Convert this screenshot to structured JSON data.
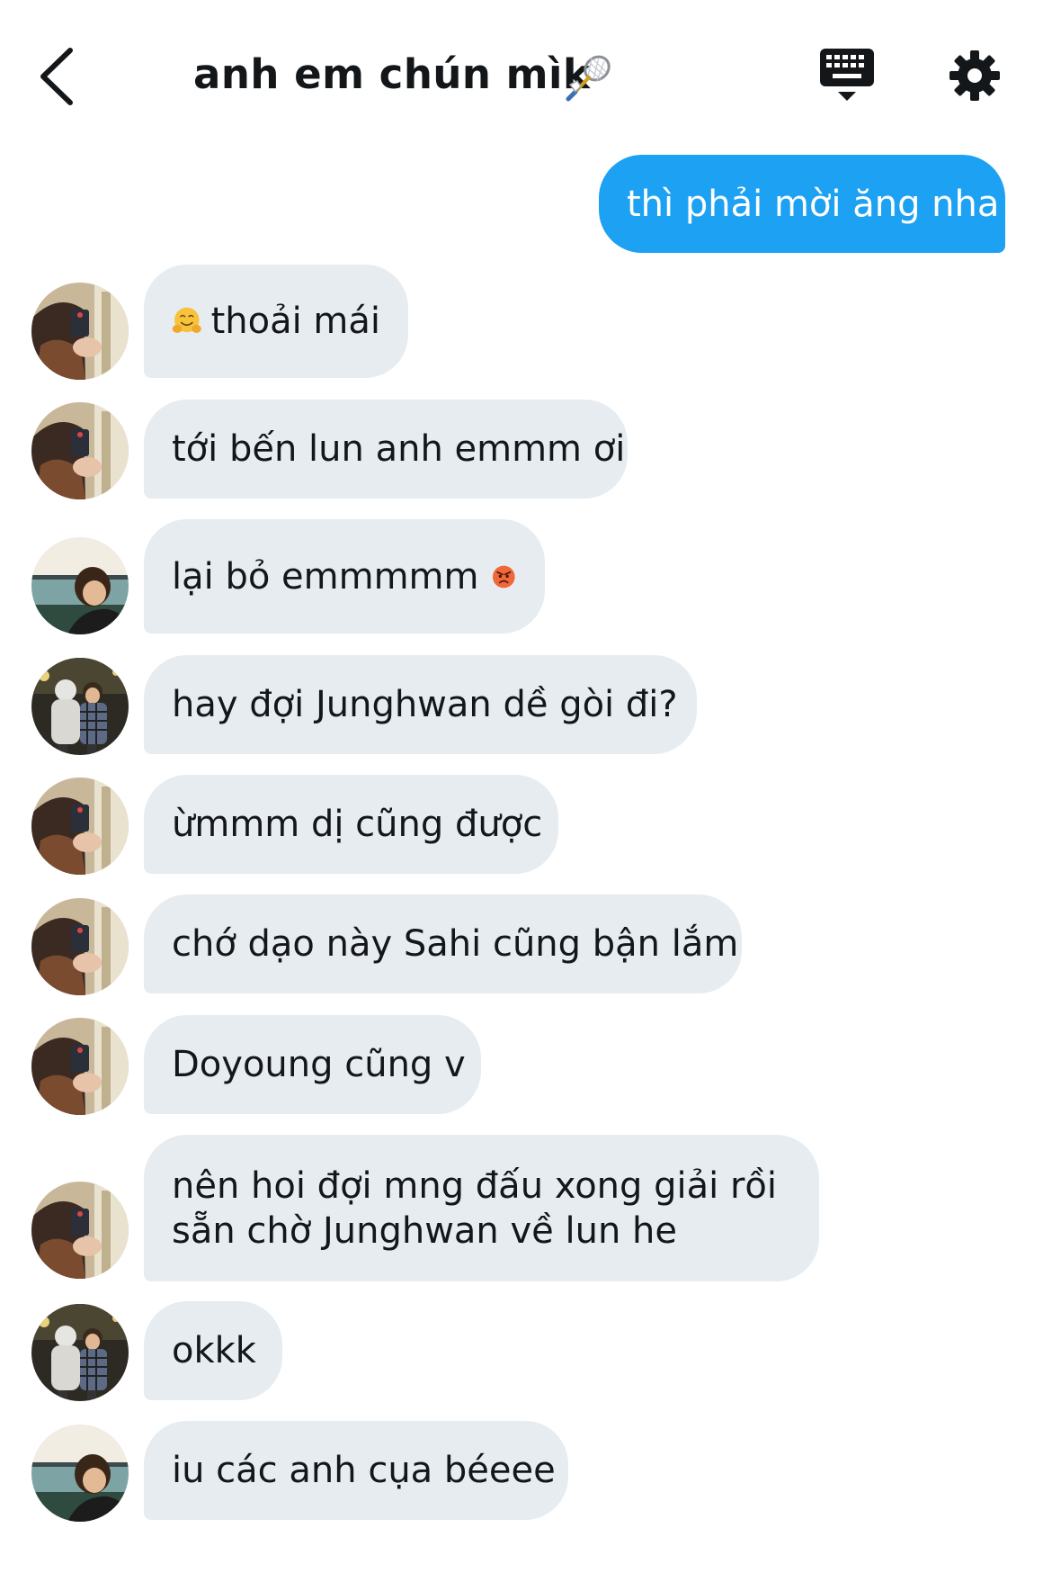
{
  "header": {
    "title": "anh em chún mìk",
    "title_icon": "badminton-icon",
    "back_icon": "chevron-left-icon",
    "keyboard_icon": "keyboard-icon",
    "settings_icon": "gear-icon"
  },
  "colors": {
    "sent_bubble": "#1da1f2",
    "received_bubble": "#e7ecf0",
    "text": "#14171a"
  },
  "messages": [
    {
      "direction": "sent",
      "text": "thì phải mời ăng nha"
    },
    {
      "direction": "received",
      "avatar": "user-a",
      "emoji": "hugging-face-emoji",
      "text": "thoải mái"
    },
    {
      "direction": "received",
      "avatar": "user-a",
      "text": "tới bến lun anh emmm ơi"
    },
    {
      "direction": "received",
      "avatar": "user-b",
      "text": "lại bỏ emmmmm",
      "emoji": "angry-face-emoji"
    },
    {
      "direction": "received",
      "avatar": "user-c",
      "text": "hay đợi Junghwan dề gòi đi?"
    },
    {
      "direction": "received",
      "avatar": "user-a",
      "text": "ừmmm dị cũng được"
    },
    {
      "direction": "received",
      "avatar": "user-a",
      "text": "chớ dạo này Sahi cũng bận lắm"
    },
    {
      "direction": "received",
      "avatar": "user-a",
      "text": "Doyoung cũng v"
    },
    {
      "direction": "received",
      "avatar": "user-a",
      "text": "nên hoi đợi mng đấu xong giải rồi\nsẵn chờ Junghwan về lun he"
    },
    {
      "direction": "received",
      "avatar": "user-c",
      "text": "okkk"
    },
    {
      "direction": "received",
      "avatar": "user-b",
      "text": "iu các anh cụa béeee"
    }
  ]
}
